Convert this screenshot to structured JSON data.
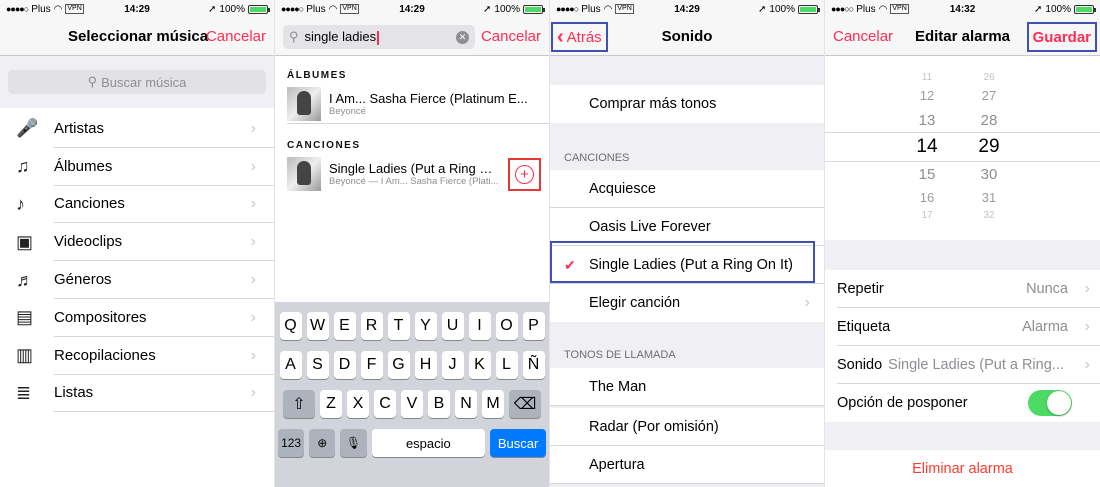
{
  "statusbars": [
    {
      "carrier": "Plus",
      "vpn": "VPN",
      "time": "14:29",
      "battery": "100%"
    },
    {
      "carrier": "Plus",
      "vpn": "VPN",
      "time": "14:29",
      "battery": "100%"
    },
    {
      "carrier": "Plus",
      "vpn": "VPN",
      "time": "14:29",
      "battery": "100%"
    },
    {
      "carrier": "Plus",
      "vpn": "VPN",
      "time": "14:32",
      "battery": "100%"
    }
  ],
  "screen1": {
    "title": "Seleccionar música",
    "cancel": "Cancelar",
    "search_placeholder": "Buscar música",
    "items": [
      {
        "label": "Artistas",
        "icon": "microphone-icon",
        "glyph": "🎤"
      },
      {
        "label": "Álbumes",
        "icon": "album-icon",
        "glyph": "♫"
      },
      {
        "label": "Canciones",
        "icon": "note-icon",
        "glyph": "♪"
      },
      {
        "label": "Videoclips",
        "icon": "video-icon",
        "glyph": "▣"
      },
      {
        "label": "Géneros",
        "icon": "guitar-icon",
        "glyph": "♬"
      },
      {
        "label": "Compositores",
        "icon": "piano-icon",
        "glyph": "▤"
      },
      {
        "label": "Recopilaciones",
        "icon": "compilation-icon",
        "glyph": "▥"
      },
      {
        "label": "Listas",
        "icon": "playlist-icon",
        "glyph": "≣"
      }
    ]
  },
  "screen2": {
    "query": "single ladies",
    "cancel": "Cancelar",
    "albums_header": "ÁLBUMES",
    "album": {
      "title": "I Am... Sasha Fierce (Platinum E...",
      "artist": "Beyoncé"
    },
    "songs_header": "CANCIONES",
    "song": {
      "title": "Single Ladies (Put a Ring O...",
      "subtitle": "Beyoncé — I Am... Sasha Fierce (Plati..."
    },
    "keyboard": {
      "row1": [
        "Q",
        "W",
        "E",
        "R",
        "T",
        "Y",
        "U",
        "I",
        "O",
        "P"
      ],
      "row2": [
        "A",
        "S",
        "D",
        "F",
        "G",
        "H",
        "J",
        "K",
        "L",
        "Ñ"
      ],
      "row3": [
        "Z",
        "X",
        "C",
        "V",
        "B",
        "N",
        "M"
      ],
      "num": "123",
      "space": "espacio",
      "search": "Buscar"
    }
  },
  "screen3": {
    "back": "Atrás",
    "title": "Sonido",
    "buy": "Comprar más tonos",
    "songs_header": "CANCIONES",
    "songs": [
      "Acquiesce",
      "Oasis   Live Forever",
      "Single Ladies (Put a Ring On It)",
      "Elegir canción"
    ],
    "ringtones_header": "TONOS DE LLAMADA",
    "ringtones": [
      "The Man",
      "Radar (Por omisión)",
      "Apertura"
    ]
  },
  "screen4": {
    "cancel": "Cancelar",
    "title": "Editar alarma",
    "save": "Guardar",
    "hours": [
      "11",
      "12",
      "13",
      "14",
      "15",
      "16",
      "17"
    ],
    "minutes": [
      "26",
      "27",
      "28",
      "29",
      "30",
      "31",
      "32"
    ],
    "options": {
      "repeat_label": "Repetir",
      "repeat_value": "Nunca",
      "label_label": "Etiqueta",
      "label_value": "Alarma",
      "sound_label": "Sonido",
      "sound_value": "Single Ladies (Put a Ring...",
      "snooze_label": "Opción de posponer"
    },
    "delete": "Eliminar alarma"
  }
}
